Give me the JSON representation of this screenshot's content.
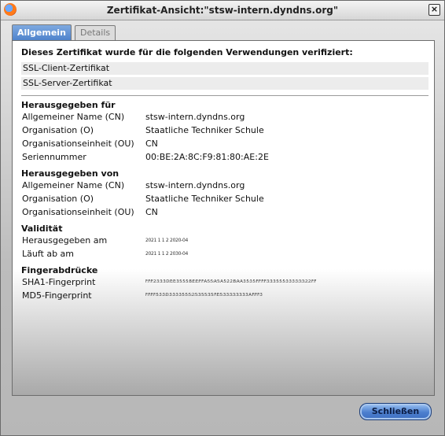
{
  "window": {
    "title": "Zertifikat-Ansicht:\"stsw-intern.dyndns.org\""
  },
  "tabs": [
    {
      "label": "Allgemein",
      "active": true
    },
    {
      "label": "Details",
      "active": false
    }
  ],
  "verified": {
    "heading": "Dieses Zertifikat wurde für die folgenden Verwendungen verifiziert:",
    "usages": [
      "SSL-Client-Zertifikat",
      "SSL-Server-Zertifikat"
    ]
  },
  "issued_to": {
    "heading": "Herausgegeben für",
    "rows": [
      {
        "label": "Allgemeiner Name (CN)",
        "value": "stsw-intern.dyndns.org"
      },
      {
        "label": "Organisation (O)",
        "value": "Staatliche Techniker Schule"
      },
      {
        "label": "Organisationseinheit (OU)",
        "value": "CN"
      },
      {
        "label": "Seriennummer",
        "value": "00:BE:2A:8C:F9:81:80:AE:2E"
      }
    ]
  },
  "issued_by": {
    "heading": "Herausgegeben von",
    "rows": [
      {
        "label": "Allgemeiner Name (CN)",
        "value": "stsw-intern.dyndns.org"
      },
      {
        "label": "Organisation (O)",
        "value": "Staatliche Techniker Schule"
      },
      {
        "label": "Organisationseinheit (OU)",
        "value": "CN"
      }
    ]
  },
  "validity": {
    "heading": "Validität",
    "rows": [
      {
        "label": "Herausgegeben am",
        "value": "2021 1 1 2 2020-04"
      },
      {
        "label": "Läuft ab am",
        "value": "2021 1 1 2 2030-04"
      }
    ]
  },
  "fingerprints": {
    "heading": "Fingerabdrücke",
    "rows": [
      {
        "label": "SHA1-Fingerprint",
        "value": "F:F:F:2:3:3:3:D:E:E:3:5:5:5:B:E:E:F:F:A:5:5:A:5:A:5:2:2:B:A:A:3:5:3:5:F:F:F:F:3:3:3:5:5:5:3:3:3:3:3:3:2:2:F:F"
      },
      {
        "label": "MD5-Fingerprint",
        "value": "F:F:F:F:5:3:3:D:3:3:3:3:5:5:5:2:5:3:5:5:3:5:F:E:5:3:3:3:3:3:3:3:3:A:F:F:F:3"
      }
    ]
  },
  "buttons": {
    "close": "Schließen"
  }
}
